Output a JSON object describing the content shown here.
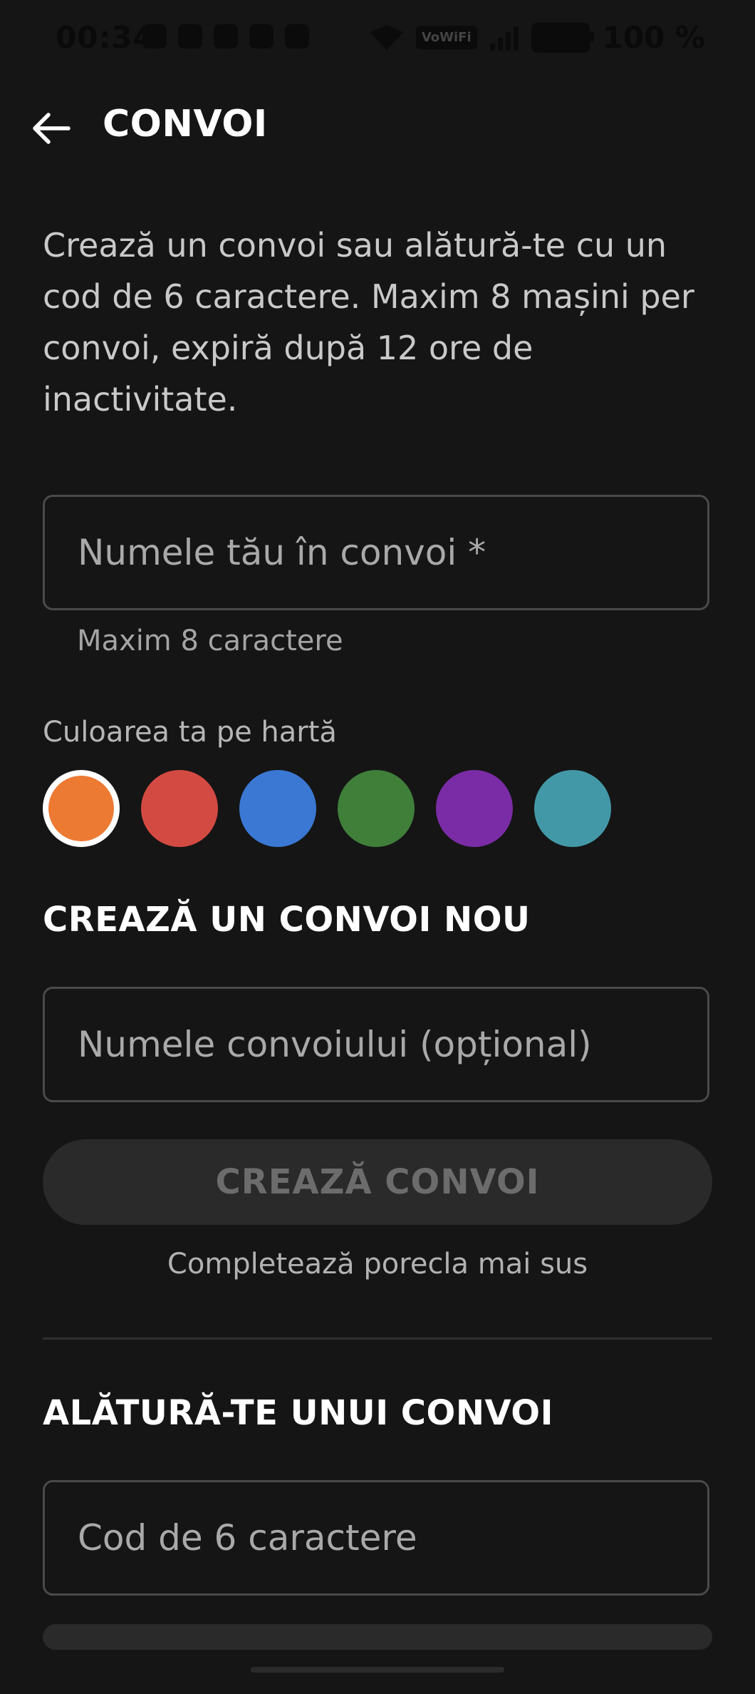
{
  "status_bar": {
    "time": "00:34",
    "wifi_badge": "VoWiFi",
    "battery": "100 %",
    "icons": [
      "alarm-icon",
      "vibrate-icon",
      "whatsapp-icon",
      "app-icon",
      "gmail-icon",
      "wifi-icon",
      "vowifi-icon",
      "signal-icon",
      "battery-icon"
    ]
  },
  "app_bar": {
    "title": "CONVOI",
    "back_icon": "arrow-left-icon"
  },
  "description": "Crează un convoi sau alătură-te cu un cod de 6 caractere. Maxim 8 mașini per convoi, expiră după 12 ore de inactivitate.",
  "nickname": {
    "placeholder": "Numele tău în convoi *",
    "value": "",
    "helper": "Maxim 8 caractere"
  },
  "color_picker": {
    "label": "Culoarea ta pe hartă",
    "selected_index": 0,
    "colors": [
      "#ED7A33",
      "#D34A42",
      "#3A78D4",
      "#3F7F3A",
      "#7A2CA6",
      "#4398A7"
    ]
  },
  "create_section": {
    "heading": "CREAZĂ UN CONVOI NOU",
    "name_placeholder": "Numele convoiului (opțional)",
    "name_value": "",
    "button_label": "CREAZĂ CONVOI",
    "hint": "Completează porecla mai sus"
  },
  "join_section": {
    "heading": "ALĂTURĂ-TE UNUI CONVOI",
    "code_placeholder": "Cod de 6 caractere",
    "code_value": ""
  }
}
